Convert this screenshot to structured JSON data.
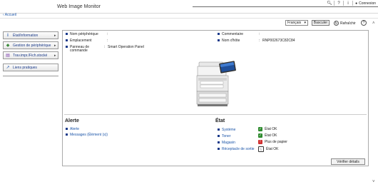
{
  "header": {
    "title": "Web Image Monitor",
    "user_label": "Connexion",
    "icons": [
      "search-icon",
      "help-icon",
      "info-icon",
      "user-icon"
    ]
  },
  "nav": {
    "home_link": "Accueil"
  },
  "toolbar": {
    "language": "Français",
    "switch_label": "Basculer",
    "refresh_label": "Rafraîchir",
    "help_symbol": "?"
  },
  "sidebar": {
    "items": [
      {
        "label": "État/Information",
        "icon": "info-icon",
        "has_arrow": true
      },
      {
        "label": "Gestion de périphérique",
        "icon": "device-management-icon",
        "has_arrow": true
      },
      {
        "label": "Trav.impr./Fich.stocké",
        "icon": "document-icon",
        "has_arrow": true
      },
      {
        "label": "Liens pratiques",
        "icon": "link-icon",
        "has_arrow": false
      }
    ]
  },
  "device": {
    "left": [
      {
        "label": "Nom périphérique",
        "value": ""
      },
      {
        "label": "Emplacement",
        "value": ""
      },
      {
        "label": "Panneau de commande",
        "value": "Smart Operation Panel"
      }
    ],
    "right": [
      {
        "label": "Commentaire",
        "value": ""
      },
      {
        "label": "Nom d'hôte",
        "value": "RNP002673C82C84"
      }
    ]
  },
  "alert": {
    "title": "Alerte",
    "links": [
      "Alerte",
      "Messages (Élément (s))"
    ]
  },
  "status": {
    "title": "État",
    "items": [
      {
        "label": "Système",
        "value": "État OK",
        "icon": "system-ok-icon",
        "color": "#2e8b2e"
      },
      {
        "label": "Toner",
        "value": "État OK",
        "icon": "toner-ok-icon",
        "color": "#2e8b2e"
      },
      {
        "label": "Magasin",
        "value": "Plus de papier",
        "icon": "paper-error-icon",
        "color": "#d03030"
      },
      {
        "label": "Réceptacle de sortie",
        "value": "État OK",
        "icon": "output-tray-icon",
        "color": "#333333"
      }
    ]
  },
  "verify_button": "Vérifier détails"
}
